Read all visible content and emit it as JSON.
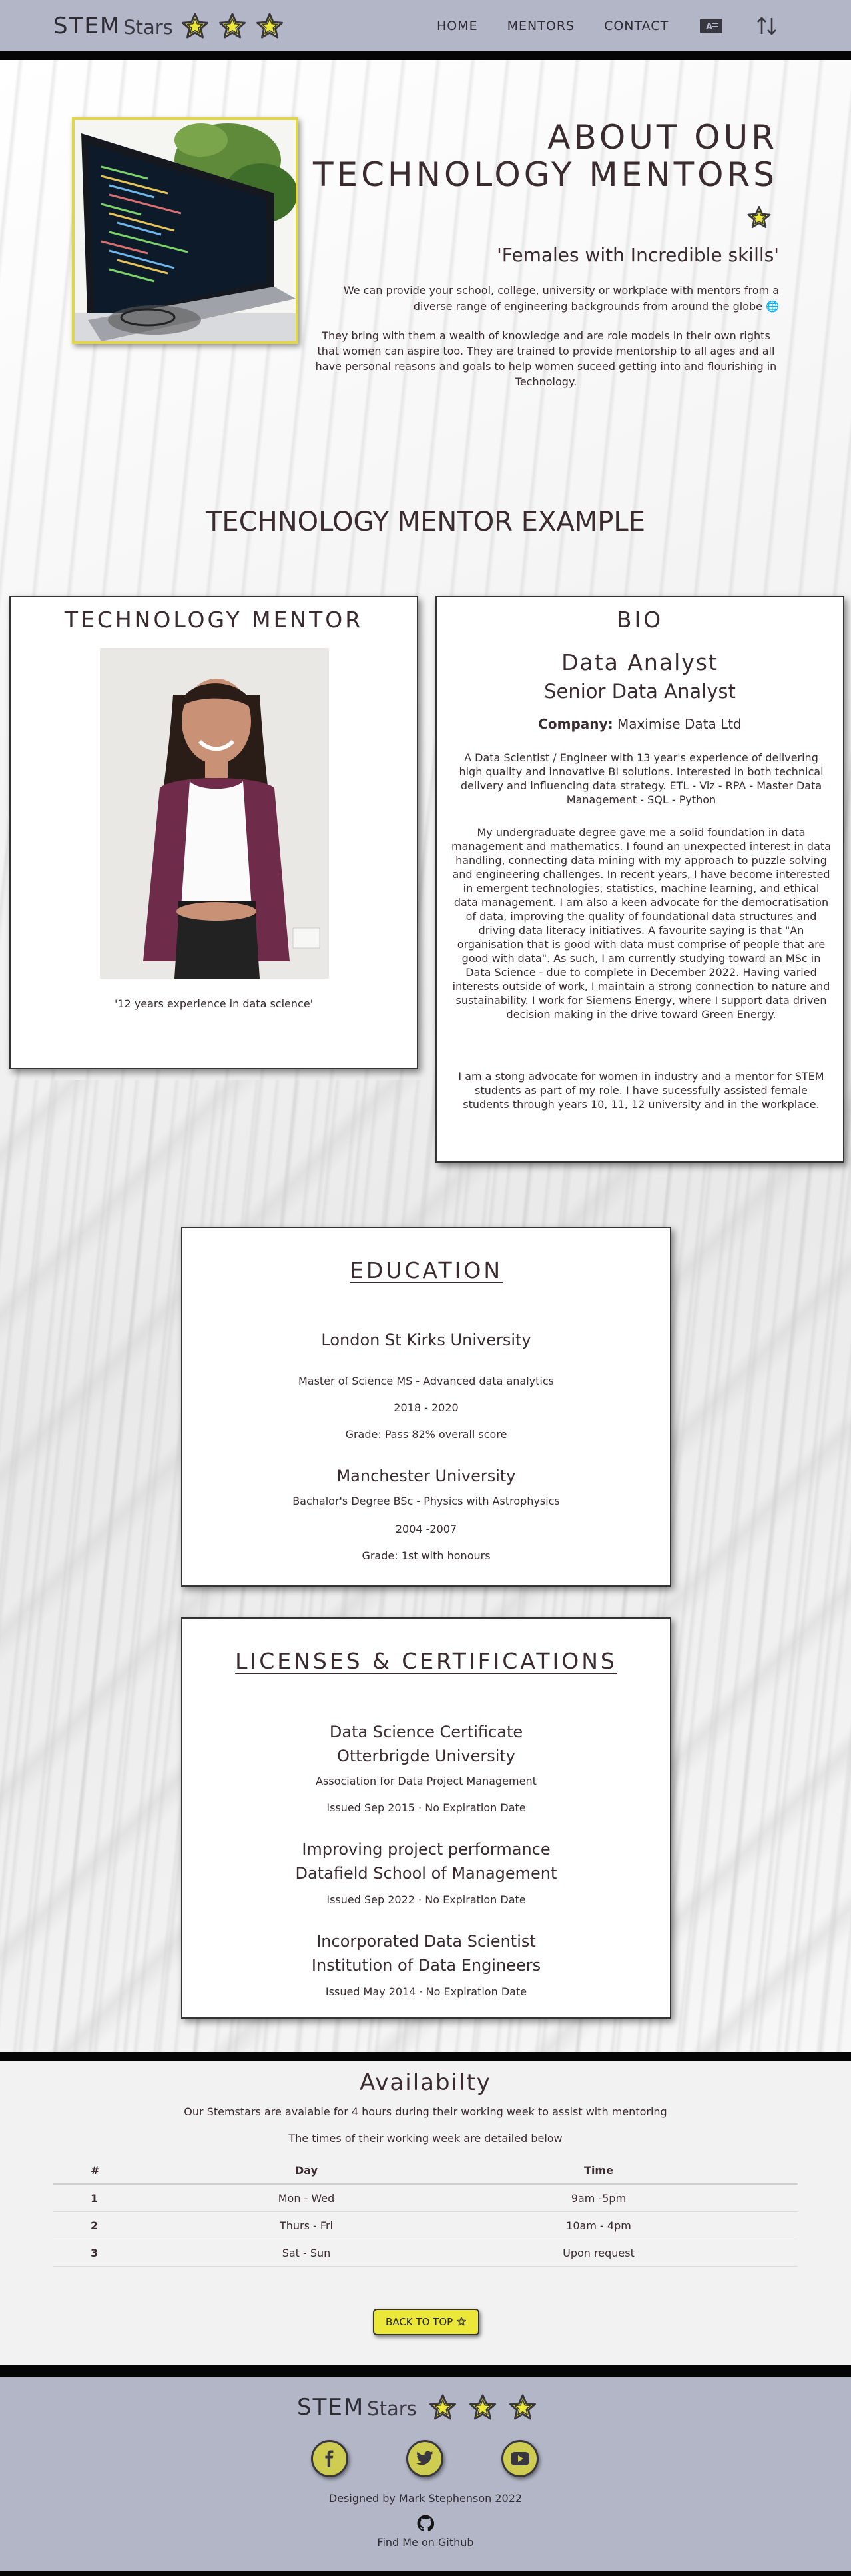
{
  "nav": {
    "brand_main": "STEM",
    "brand_sub": "Stars",
    "links": [
      "HOME",
      "MENTORS",
      "CONTACT"
    ],
    "icons": [
      "language-card-icon",
      "sort-arrows-icon"
    ]
  },
  "colors": {
    "nav_bg": "#b3b6c7",
    "accent_yellow": "#ebe83a",
    "text": "#3a2b2f",
    "bar": "#050505"
  },
  "hero": {
    "title_line1": "ABOUT OUR",
    "title_line2": "TECHNOLOGY MENTORS",
    "quote": "'Females with Incredible skills'",
    "p1": "We can provide your school, college, university or workplace with mentors from a diverse range of engineering backgrounds from around the globe 🌐",
    "p2": "They bring with them a wealth of knowledge and are role models in their own rights that women can aspire too. They are trained to provide mentorship to all ages and all have personal reasons and goals to help women suceed getting into and flourishing in Technology."
  },
  "example": {
    "title": "TECHNOLOGY MENTOR EXAMPLE",
    "mentor_heading": "TECHNOLOGY MENTOR",
    "mentor_caption": "'12 years experience in data science'"
  },
  "bio": {
    "heading": "BIO",
    "role1": "Data Analyst",
    "role2": "Senior Data Analyst",
    "company_label": "Company:",
    "company_name": "Maximise Data Ltd",
    "p1": "A Data Scientist / Engineer with 13 year's experience of delivering high quality and innovative BI solutions. Interested in both technical delivery and influencing data strategy. ETL - Viz - RPA - Master Data Management - SQL - Python",
    "p2": "My undergraduate degree gave me a solid foundation in data management and mathematics. I found an unexpected interest in data handling, connecting data mining with my approach to puzzle solving and engineering challenges. In recent years, I have become interested in emergent technologies, statistics, machine learning, and ethical data management. I am also a keen advocate for the democratisation of data, improving the quality of foundational data structures and driving data literacy initiatives. A favourite saying is that \"An organisation that is good with data must comprise of people that are good with data\". As such, I am currently studying toward an MSc in Data Science - due to complete in December 2022. Having varied interests outside of work, I maintain a strong connection to nature and sustainability. I work for Siemens Energy, where I support data driven decision making in the drive toward Green Energy.",
    "p3": "I am a stong advocate for women in industry and a mentor for STEM students as part of my role. I have sucessfully assisted female students through years 10, 11, 12 university and in the workplace."
  },
  "education": {
    "heading": "EDUCATION",
    "entries": [
      {
        "school": "London St Kirks University",
        "degree": "Master of Science MS - Advanced data analytics",
        "years": "2018 - 2020",
        "grade": "Grade: Pass 82% overall score"
      },
      {
        "school": "Manchester University",
        "degree": "Bachalor's Degree BSc - Physics with Astrophysics",
        "years": "2004 -2007",
        "grade": "Grade: 1st with honours"
      }
    ]
  },
  "licenses": {
    "heading": "LICENSES & CERTIFICATIONS",
    "entries": [
      {
        "name": "Data Science Certificate",
        "issuer": "Otterbrigde University",
        "sub": "Association for Data Project Management",
        "issued": "Issued Sep 2015 · No Expiration Date"
      },
      {
        "name": "Improving project performance",
        "issuer": "Datafield School of Management",
        "issued": "Issued Sep 2022 · No Expiration Date"
      },
      {
        "name": "Incorporated Data Scientist",
        "issuer": "Institution of Data Engineers",
        "issued": "Issued May 2014 · No Expiration Date"
      }
    ]
  },
  "availability": {
    "title": "Availabilty",
    "p1": "Our Stemstars are avaiable for 4 hours during their working week to assist with mentoring",
    "p2": "The times of their working week are detailed below",
    "columns": [
      "#",
      "Day",
      "Time"
    ],
    "rows": [
      [
        "1",
        "Mon - Wed",
        "9am -5pm"
      ],
      [
        "2",
        "Thurs - Fri",
        "10am - 4pm"
      ],
      [
        "3",
        "Sat - Sun",
        "Upon request"
      ]
    ],
    "back_button": "BACK TO TOP"
  },
  "footer": {
    "brand_main": "STEM",
    "brand_sub": "Stars",
    "socials": [
      "facebook-icon",
      "twitter-icon",
      "youtube-icon"
    ],
    "credit": "Designed by Mark Stephenson 2022",
    "github_link": "Find Me on Github"
  }
}
